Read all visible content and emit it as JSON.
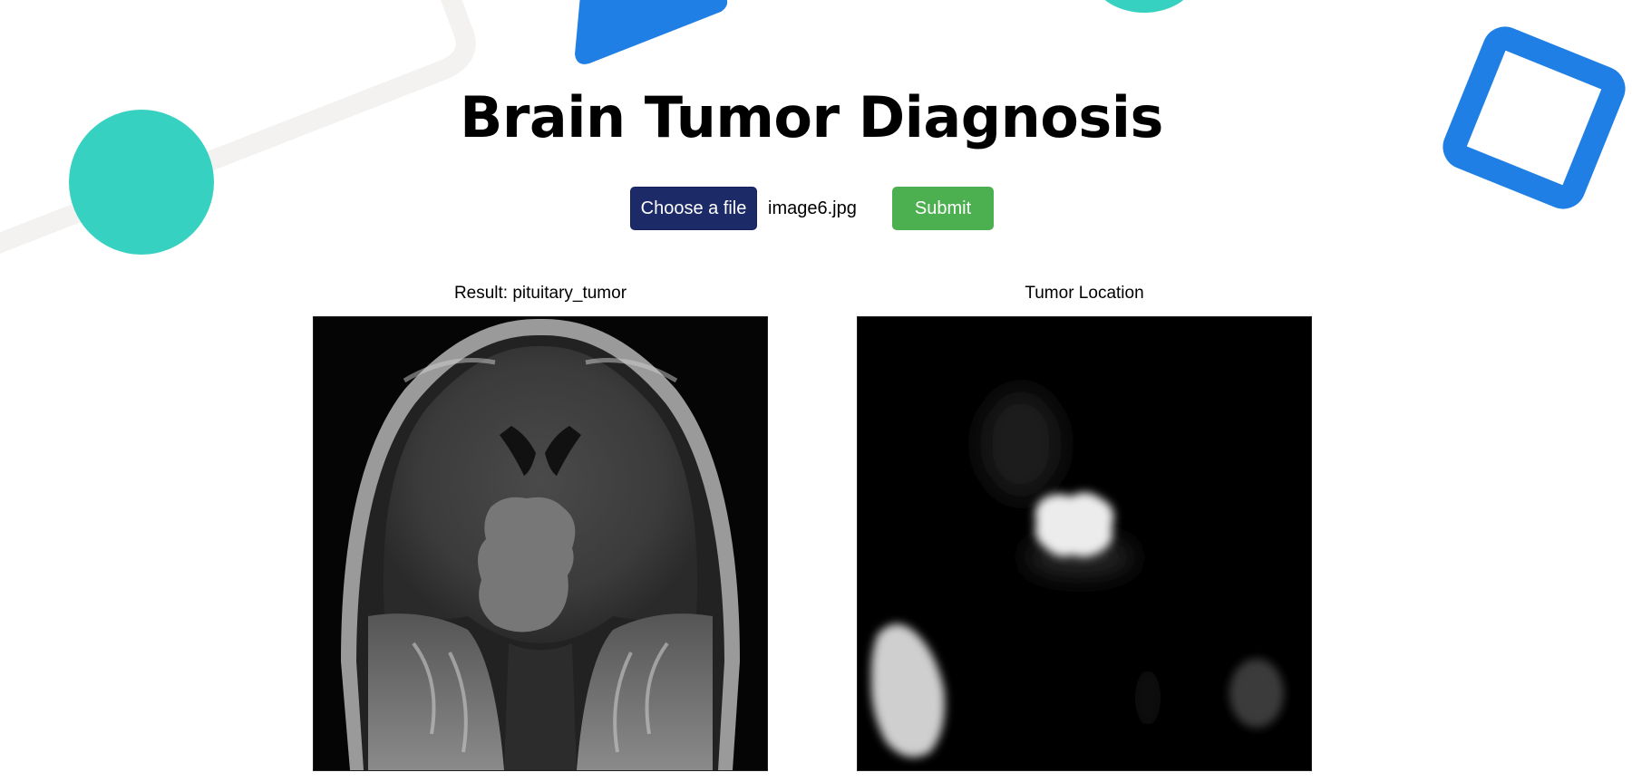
{
  "header": {
    "title": "Brain Tumor Diagnosis"
  },
  "upload": {
    "choose_label": "Choose a file",
    "file_name": "image6.jpg",
    "submit_label": "Submit"
  },
  "results": {
    "prediction_caption": "Result: pituitary_tumor",
    "location_caption": "Tumor Location"
  },
  "theme": {
    "teal": "#36d1c0",
    "blue": "#1f7fe5",
    "navy_button": "#1c2b68",
    "green_button": "#4caf50",
    "faint_line": "#f3f3f3"
  }
}
